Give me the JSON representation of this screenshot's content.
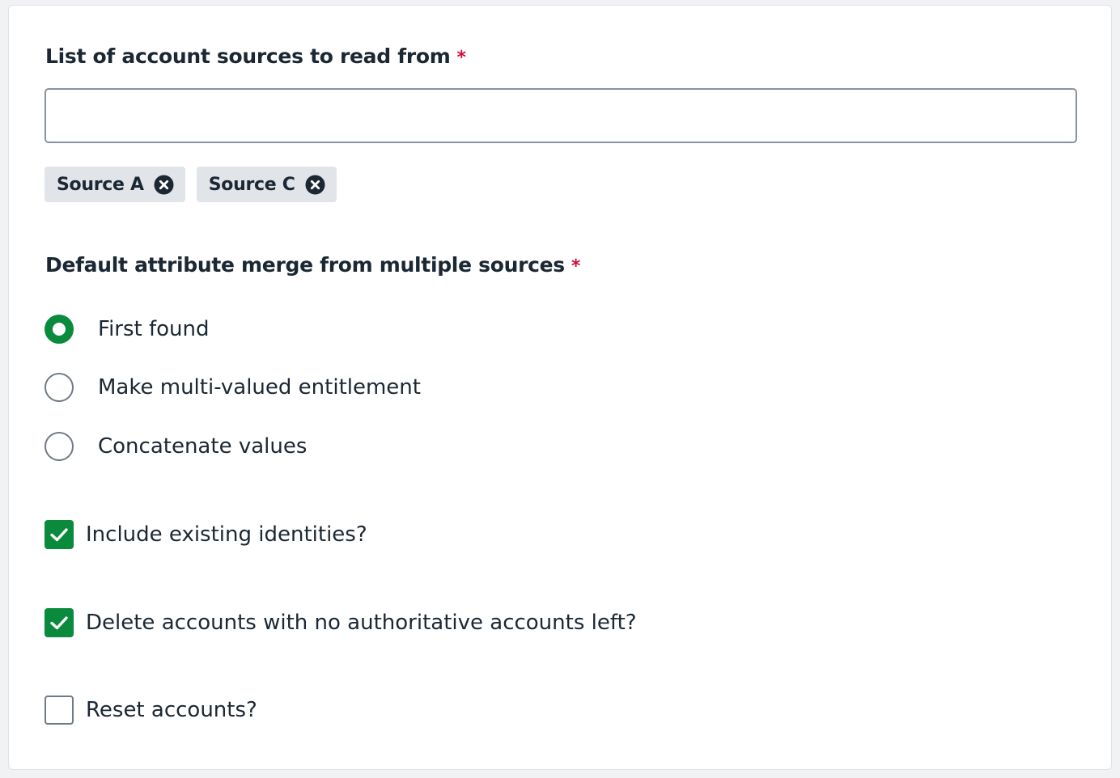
{
  "sources": {
    "label": "List of account sources to read from",
    "required_marker": "*",
    "input_value": "",
    "tags": [
      {
        "label": "Source A"
      },
      {
        "label": "Source C"
      }
    ]
  },
  "merge": {
    "label": "Default attribute merge from multiple sources",
    "required_marker": "*",
    "options": [
      {
        "label": "First found",
        "selected": true
      },
      {
        "label": "Make multi-valued entitlement",
        "selected": false
      },
      {
        "label": "Concatenate values",
        "selected": false
      }
    ]
  },
  "checkboxes": [
    {
      "label": "Include existing identities?",
      "checked": true
    },
    {
      "label": "Delete accounts with no authoritative accounts left?",
      "checked": true
    },
    {
      "label": "Reset accounts?",
      "checked": false
    }
  ],
  "colors": {
    "accent": "#0a8a3d",
    "required": "#d0103a",
    "tag_bg": "#e1e4e8"
  }
}
